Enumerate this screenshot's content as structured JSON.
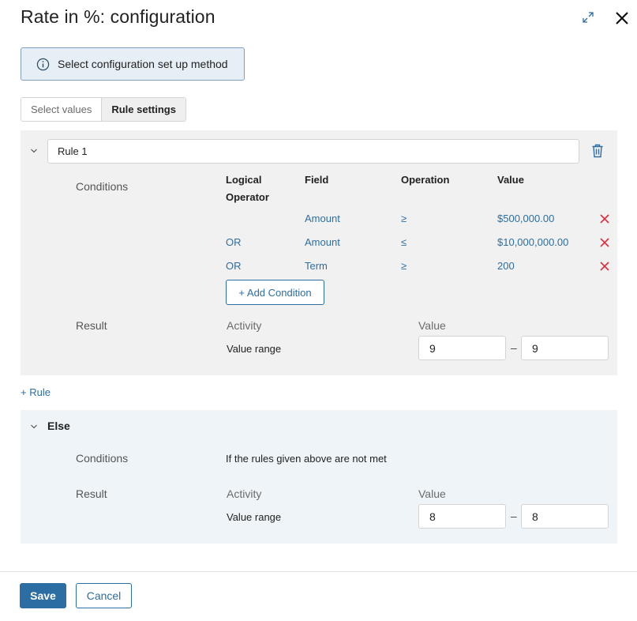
{
  "dialog": {
    "title": "Rate in %: configuration",
    "expand_icon": "expand-icon",
    "close_icon": "close-icon"
  },
  "info": {
    "icon": "info-icon",
    "text": "Select configuration set up method"
  },
  "tabs": [
    {
      "label": "Select values",
      "active": false
    },
    {
      "label": "Rule settings",
      "active": true
    }
  ],
  "rule": {
    "name": "Rule 1",
    "conditions_label": "Conditions",
    "headers": {
      "logical_operator": "Logical Operator",
      "field": "Field",
      "operation": "Operation",
      "value": "Value"
    },
    "conditions": [
      {
        "operator": "",
        "field": "Amount",
        "operation": "≥",
        "value": "$500,000.00"
      },
      {
        "operator": "OR",
        "field": "Amount",
        "operation": "≤",
        "value": "$10,000,000.00"
      },
      {
        "operator": "OR",
        "field": "Term",
        "operation": "≥",
        "value": "200"
      }
    ],
    "add_condition_label": "+ Add Condition",
    "result_label": "Result",
    "activity_header": "Activity",
    "value_header": "Value",
    "activity": "Value range",
    "range_from": "9",
    "range_to": "9",
    "range_sep": "–"
  },
  "add_rule_label": "+ Rule",
  "else": {
    "title": "Else",
    "conditions_label": "Conditions",
    "conditions_text": "If the rules given above are not met",
    "result_label": "Result",
    "activity_header": "Activity",
    "value_header": "Value",
    "activity": "Value range",
    "range_from": "8",
    "range_to": "8",
    "range_sep": "–"
  },
  "footer": {
    "save_label": "Save",
    "cancel_label": "Cancel"
  },
  "colors": {
    "accent": "#2c6ea3",
    "delete": "#e0293a",
    "rule_bg": "#f1f1f1",
    "else_bg": "#eef4f8",
    "info_bg": "#e7eff6"
  }
}
